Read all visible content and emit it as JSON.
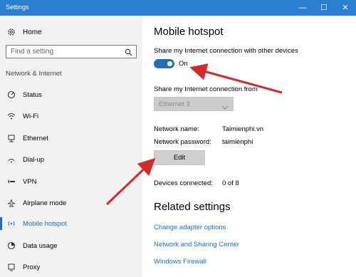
{
  "window": {
    "title": "Settings",
    "controls": {
      "minimize": "—",
      "maximize": "☐",
      "close": "✕"
    }
  },
  "sidebar": {
    "home_label": "Home",
    "search_placeholder": "Find a setting",
    "section_label": "Network & Internet",
    "items": [
      {
        "label": "Status",
        "icon": "status-icon",
        "active": false
      },
      {
        "label": "Wi-Fi",
        "icon": "wifi-icon",
        "active": false
      },
      {
        "label": "Ethernet",
        "icon": "ethernet-icon",
        "active": false
      },
      {
        "label": "Dial-up",
        "icon": "dialup-icon",
        "active": false
      },
      {
        "label": "VPN",
        "icon": "vpn-icon",
        "active": false
      },
      {
        "label": "Airplane mode",
        "icon": "airplane-icon",
        "active": false
      },
      {
        "label": "Mobile hotspot",
        "icon": "hotspot-icon",
        "active": true
      },
      {
        "label": "Data usage",
        "icon": "data-usage-icon",
        "active": false
      },
      {
        "label": "Proxy",
        "icon": "proxy-icon",
        "active": false
      }
    ]
  },
  "main": {
    "title": "Mobile hotspot",
    "share_label": "Share my Internet connection with other devices",
    "toggle_state": "On",
    "toggle_on": true,
    "share_from_label": "Share my Internet connection from",
    "share_from_value": "Ethernet 3",
    "network_name_label": "Network name:",
    "network_name_value": "Taimienphi.vn",
    "network_password_label": "Network password:",
    "network_password_value": "taimienphi",
    "edit_button": "Edit",
    "devices_connected_label": "Devices connected:",
    "devices_connected_value": "0 of 8",
    "related_title": "Related settings",
    "related_links": [
      "Change adapter options",
      "Network and Sharing Center",
      "Windows Firewall"
    ]
  },
  "colors": {
    "accent": "#1c6fc2",
    "titlebar": "#2b7fd0",
    "sidebar_bg": "#f2f2f2",
    "annotation_arrow": "#d42a2a"
  }
}
